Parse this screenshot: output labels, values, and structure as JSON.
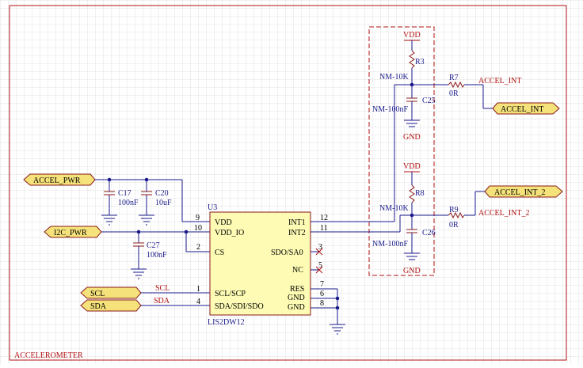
{
  "sheet_title": "ACCELEROMETER",
  "chip": {
    "ref": "U3",
    "part": "LIS2DW12",
    "left_pins": [
      {
        "num": "9",
        "name": "VDD"
      },
      {
        "num": "10",
        "name": "VDD_IO"
      },
      {
        "num": "2",
        "name": "CS"
      },
      {
        "num": "1",
        "name": "SCL/SCP"
      },
      {
        "num": "4",
        "name": "SDA/SDI/SDO"
      }
    ],
    "right_pins": [
      {
        "num": "12",
        "name": "INT1"
      },
      {
        "num": "11",
        "name": "INT2"
      },
      {
        "num": "3",
        "name": "SDO/SA0"
      },
      {
        "num": "5",
        "name": "NC"
      },
      {
        "num": "7",
        "name": "RES"
      },
      {
        "num": "6",
        "name": "GND"
      },
      {
        "num": "8",
        "name": "GND"
      }
    ]
  },
  "ports": {
    "accel_pwr": "ACCEL_PWR",
    "i2c_pwr": "I2C_PWR",
    "scl": "SCL",
    "sda": "SDA",
    "accel_int": "ACCEL_INT",
    "accel_int_2": "ACCEL_INT_2"
  },
  "net_labels": {
    "scl": "SCL",
    "sda": "SDA",
    "accel_int": "ACCEL_INT",
    "accel_int_2": "ACCEL_INT_2"
  },
  "caps": {
    "c17": {
      "ref": "C17",
      "value": "100nF"
    },
    "c20": {
      "ref": "C20",
      "value": "10uF"
    },
    "c27": {
      "ref": "C27",
      "value": "100nF"
    },
    "c25": {
      "ref": "C25",
      "value": "NM-100nF"
    },
    "c26": {
      "ref": "C26",
      "value": "NM-100nF"
    }
  },
  "resistors": {
    "r3": {
      "ref": "R3",
      "value": "NM-10K"
    },
    "r7": {
      "ref": "R7",
      "value": "0R"
    },
    "r8": {
      "ref": "R8",
      "value": "NM-10K"
    },
    "r9": {
      "ref": "R9",
      "value": "0R"
    }
  },
  "power": {
    "vdd": "VDD",
    "gnd": "GND"
  },
  "colors": {
    "wire": "#1a1a8c",
    "border": "#b01010",
    "port_fill": "#f5e27a",
    "chip_fill": "#fdfbb4"
  }
}
